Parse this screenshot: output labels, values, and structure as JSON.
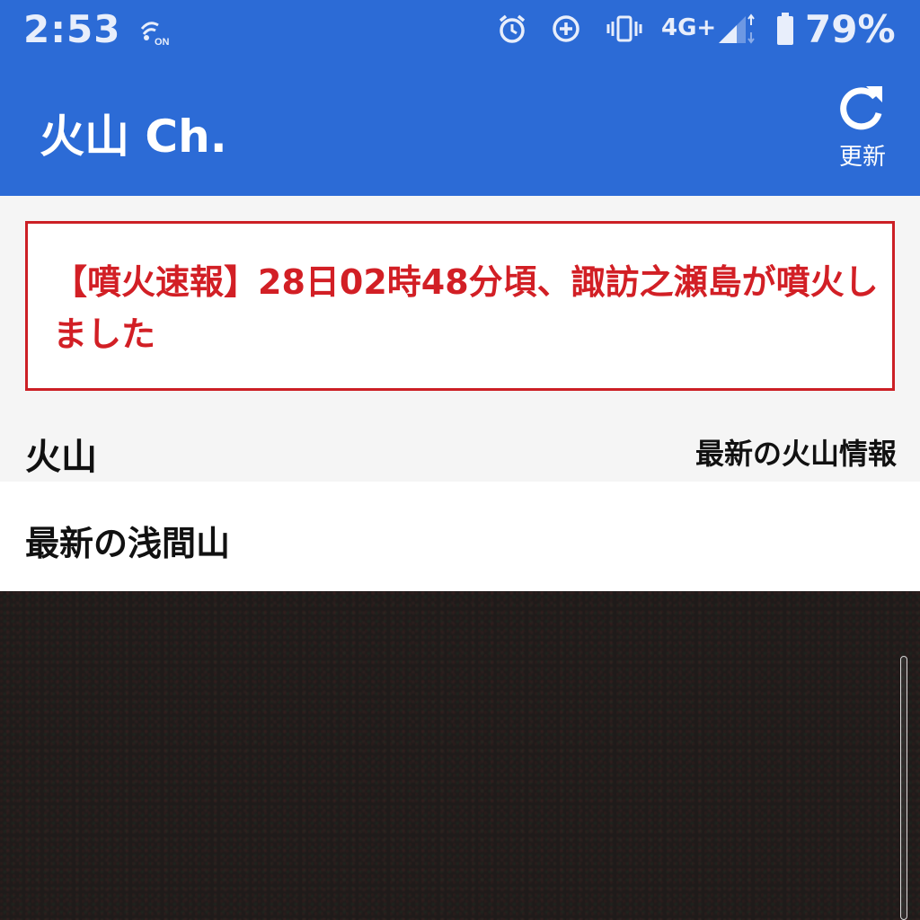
{
  "status_bar": {
    "time": "2:53",
    "network": "4G+",
    "battery": "79%",
    "icons": [
      "nfc-on-icon",
      "alarm-icon",
      "data-saver-icon",
      "vibrate-icon",
      "signal-icon",
      "battery-icon"
    ]
  },
  "app_bar": {
    "title": "火山 Ch.",
    "refresh_label": "更新"
  },
  "alert": {
    "text": "【噴火速報】28日02時48分頃、諏訪之瀬島が噴火しました",
    "color": "#d21f25"
  },
  "section": {
    "title": "火山",
    "link": "最新の火山情報"
  },
  "subsection": {
    "title": "最新の浅間山"
  },
  "colors": {
    "app_bar": "#2c6bd6",
    "alert_border": "#cc1f25"
  }
}
